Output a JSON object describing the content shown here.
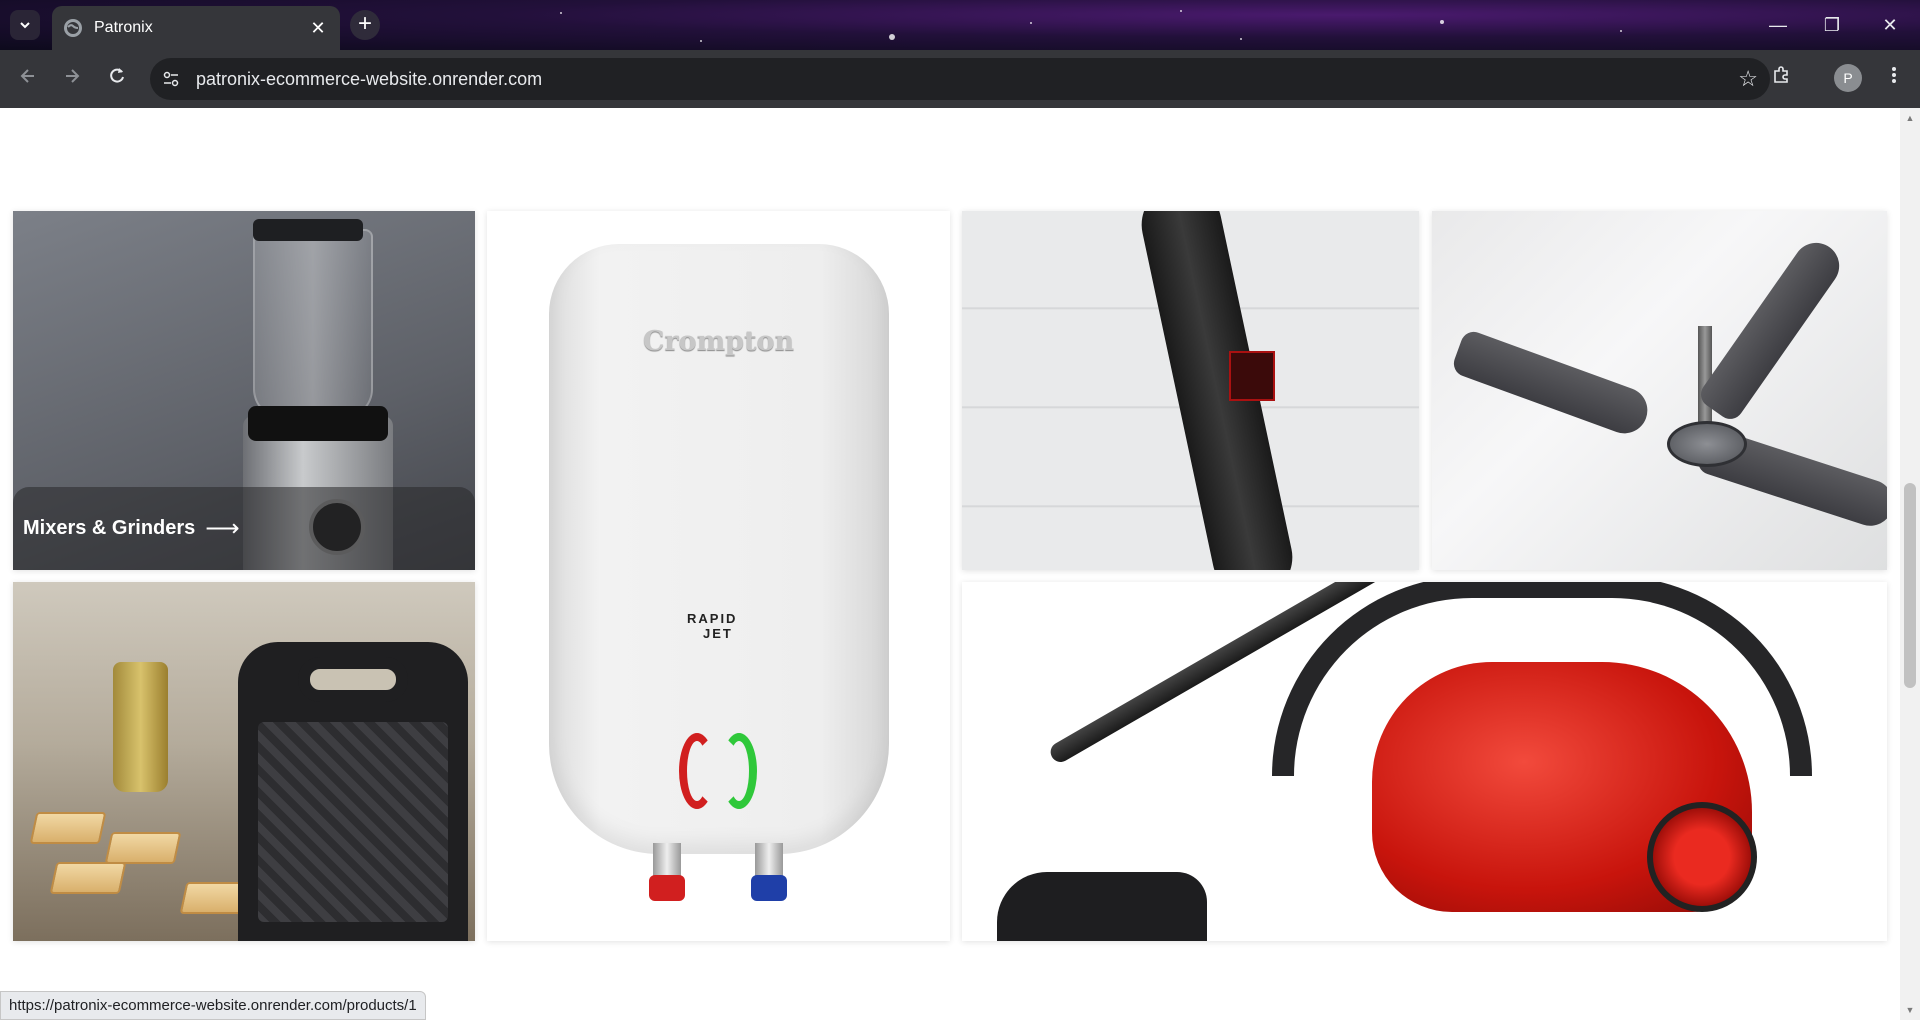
{
  "browser": {
    "tab": {
      "title": "Patronix",
      "favicon": "globe-icon"
    },
    "url": "patronix-ecommerce-website.onrender.com",
    "profile_initial": "P"
  },
  "page": {
    "tiles": [
      {
        "id": "mixers",
        "label": "Mixers & Grinders",
        "arrow": "⟶",
        "image": "mixer-grinder"
      },
      {
        "id": "water-heater",
        "brand": "Crompton",
        "model_line1": "RAPID",
        "model_line2": "JET",
        "image": "water-heater"
      },
      {
        "id": "trimmer",
        "image": "beard-trimmer"
      },
      {
        "id": "fan",
        "image": "ceiling-fan"
      },
      {
        "id": "sandwich-maker",
        "image": "sandwich-maker"
      },
      {
        "id": "vacuum",
        "image": "vacuum-cleaner"
      }
    ]
  },
  "status_link": "https://patronix-ecommerce-website.onrender.com/products/1"
}
